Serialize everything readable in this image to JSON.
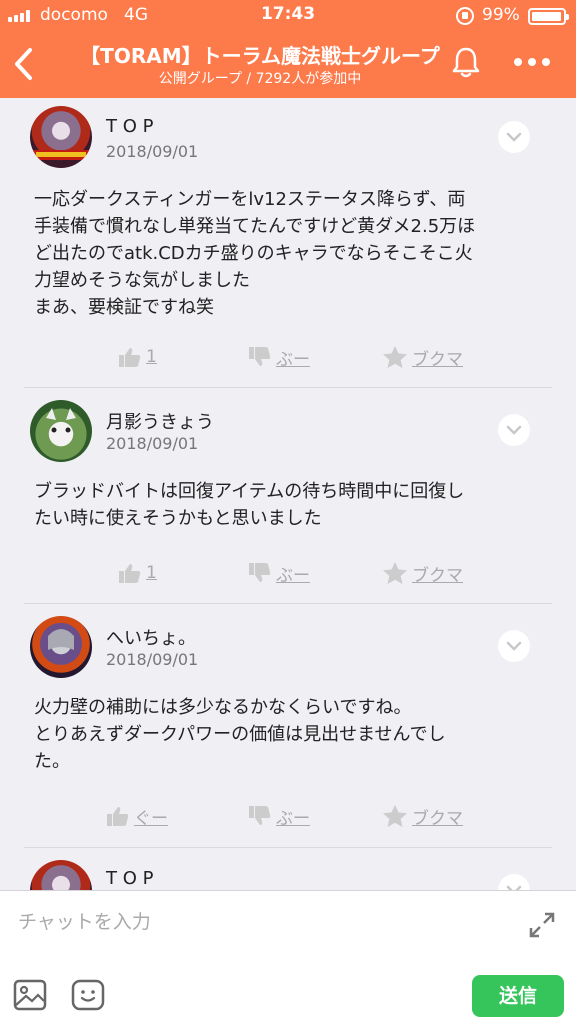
{
  "status_bar": {
    "carrier": "docomo",
    "network": "4G",
    "time": "17:43",
    "battery": "99%"
  },
  "header": {
    "title": "【TORAM】トーラム魔法戦士グループ",
    "subtitle": "公開グループ / 7292人が参加中"
  },
  "posts": [
    {
      "user": "T O P",
      "date": "2018/09/01",
      "text": "一応ダークスティンガーをlv12ステータス降らず、両\n手装備で慣れなし単発当てたんですけど黄ダメ2.5万ほ\nど出たのでatk.CDカチ盛りのキャラでならそこそこ火\n力望めそうな気がしました\nまあ、要検証ですね笑",
      "like": "1",
      "dislike": "ぶー",
      "bookmark": "ブクマ"
    },
    {
      "user": "月影うきょう",
      "date": "2018/09/01",
      "text": "ブラッドバイトは回復アイテムの待ち時間中に回復し\nたい時に使えそうかもと思いました",
      "like": "1",
      "dislike": "ぶー",
      "bookmark": "ブクマ"
    },
    {
      "user": "へいちょ。",
      "date": "2018/09/01",
      "text": "火力壁の補助には多少なるかなくらいですね。\nとりあえずダークパワーの価値は見出せませんでし\nた。",
      "like": "ぐー",
      "dislike": "ぶー",
      "bookmark": "ブクマ"
    },
    {
      "user": "T O P"
    }
  ],
  "composer": {
    "placeholder": "チャットを入力",
    "send_label": "送信"
  },
  "colors": {
    "header": "#fd7a4b",
    "send": "#36c55b",
    "background": "#efeff4"
  }
}
